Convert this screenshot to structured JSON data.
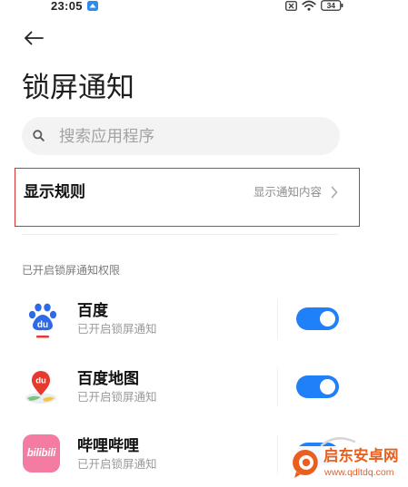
{
  "status_bar": {
    "time": "23:05",
    "battery": "34",
    "icons": [
      "notification-icon",
      "sim-off-icon",
      "wifi-icon",
      "battery-icon"
    ]
  },
  "header": {
    "back_icon": "back-arrow-icon",
    "title": "锁屏通知"
  },
  "search": {
    "icon": "search-icon",
    "placeholder": "搜索应用程序",
    "value": ""
  },
  "display_rule": {
    "label": "显示规则",
    "value": "显示通知内容",
    "icon": "chevron-right-icon",
    "highlighted": true
  },
  "section": {
    "title": "已开启锁屏通知权限"
  },
  "apps": [
    {
      "name": "百度",
      "status": "已开启锁屏通知",
      "enabled": true,
      "icon": "baidu-icon",
      "icon_text": "du"
    },
    {
      "name": "百度地图",
      "status": "已开启锁屏通知",
      "enabled": true,
      "icon": "baidu-map-icon",
      "icon_text": "du"
    },
    {
      "name": "哔哩哔哩",
      "status": "已开启锁屏通知",
      "enabled": true,
      "icon": "bilibili-icon",
      "icon_text": "bilibili"
    }
  ],
  "watermark": {
    "name": "启东安卓网",
    "url": "www.qdltdq.com"
  },
  "colors": {
    "accent": "#1f80f8",
    "highlight_border": "#d8342f",
    "text_primary": "#1a1a1a",
    "text_secondary": "#8c8c8c",
    "search_background": "#f3f3f3",
    "watermark": "#e95f1f",
    "bilibili_pink": "#f47ba2",
    "baidu_blue": "#2e6ae8",
    "map_pin_red": "#e8392f"
  }
}
